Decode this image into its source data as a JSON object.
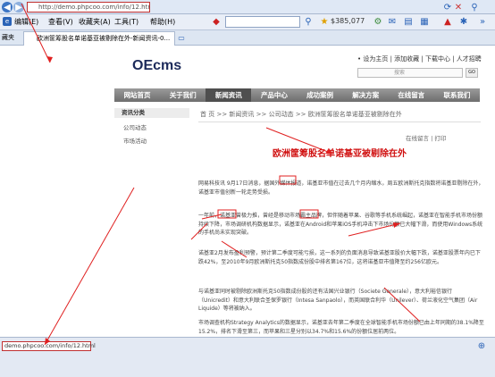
{
  "browser": {
    "url": "http://demo.phpcoo.com/info/12.html",
    "menu": [
      "编辑(E)",
      "查看(V)",
      "收藏夹(A)",
      "工具(T)",
      "帮助(H)"
    ],
    "counter": "$385,077",
    "favorites_label": "藏夹",
    "tab_title": "欧洲筐筹股名单诺基亚被剔除在外-新闻资讯-0...",
    "status_url": "demo.phpcoo.com/info/12.html"
  },
  "site": {
    "logo": "OEcms",
    "toplinks": "• 设为主页 | 添加收藏 | 下载中心 | 人才招聘",
    "search_placeholder": "搜索",
    "search_btn": "GO",
    "nav": [
      "网站首页",
      "关于我们",
      "新闻资讯",
      "产品中心",
      "成功案例",
      "解决方案",
      "在线留言",
      "联系我们"
    ],
    "active_nav": "新闻资讯",
    "sidebar": {
      "heading": "资讯分类",
      "items": [
        "公司动态",
        "市场活动"
      ]
    },
    "breadcrumb": "首 页  >>  新闻资讯  >>  公司动态  >>  欧洲筐筹股名单诺基亚被剔除在外",
    "tools": "在线留言  |  打印",
    "article_title": "欧洲筐筹股名单诺基亚被剔除在外",
    "paragraphs": [
      "网易科技讯 9月17日消息，据国外媒体报道，诺基亚市值在过去几个月内缩水，周五欧洲斯托克指数将诺基亚剔除在外，诺基亚市值创新一轮走势受损。",
      "一年前，诺基亚曾极力推，曾经是移动市场霸主品牌，但伴随着苹果、谷歌等手机系统崛起，诺基亚在智能手机市场份额持续下降，市场调研机构数据显示，诺基亚在Android和苹果iOS手机冲击下市场份额已大幅下滑，而使用Windows系统的手机尚未实现突破。",
      "诺基亚2月发布盈利预警，预计第二季度可能亏损，这一系列的负面消息导致诺基亚股价大幅下跌，诺基亚股票年内已下跌42%，至2010年9月欧洲斯托克50指数成份股中排名第167位，这将诺基亚市值降至约256亿欧元。",
      "与诺基亚同时被剔除欧洲斯托克50指数成份股的还有法国兴业银行（Societe Generale），意大利裕信银行（Unicredit）和意大利联合圣保罗银行（Intesa Sanpaolo），而英国联合利华（Unilever）、荷兰液化空气集团（Air Liquide）等将被纳入。",
      "市场调查机构Strategy Analytics的数据显示，诺基亚去年第二季度在全球智能手机市场份额已由上年同期的38.1%降至15.2%，排名下滑至第三，而苹果和三星分别以34.7%和15.6%的份额位居前两位。"
    ]
  },
  "colors": {
    "accent": "#d01010",
    "nav_bg": "#7a7a7a",
    "annotation": "#e02020"
  }
}
